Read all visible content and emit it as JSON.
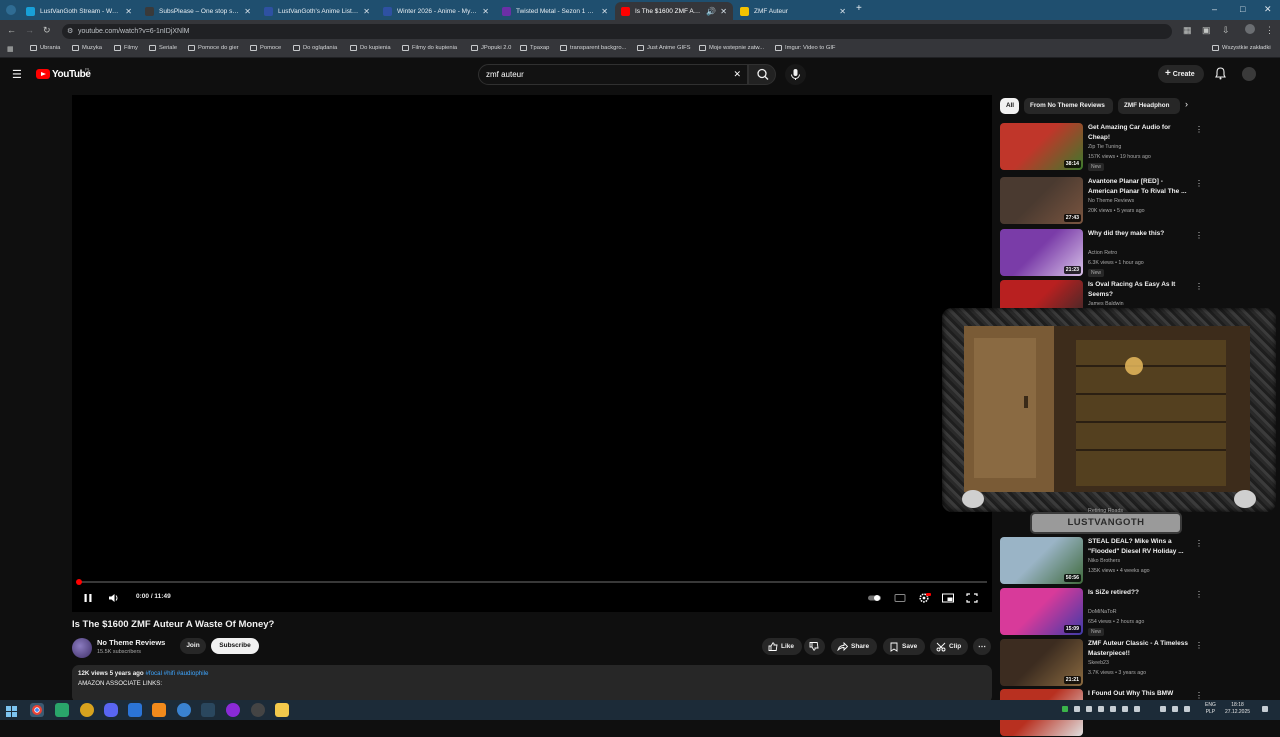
{
  "browser": {
    "tabs": [
      {
        "title": "LustVanGoth Stream - Watch Li",
        "favicon_color": "#18a0d8"
      },
      {
        "title": "SubsPlease – One stop shop fo",
        "favicon_color": "#3a3a3a"
      },
      {
        "title": "LustVanGoth's Anime List - My",
        "favicon_color": "#2e51a2"
      },
      {
        "title": "Winter 2026 - Anime - MyAnim",
        "favicon_color": "#2e51a2"
      },
      {
        "title": "Twisted Metal - Sezon 1 Odcin",
        "favicon_color": "#6b2fa6"
      },
      {
        "title": "Is The $1600 ZMF Auteur A",
        "favicon_color": "#ff0000"
      },
      {
        "title": "ZMF Auteur",
        "favicon_color": "#f2c200"
      }
    ],
    "new_tab": "+",
    "url": "youtube.com/watch?v=6-1nIDjXNlM",
    "bookmarks": [
      "Ubrania",
      "Muzyka",
      "Filmy",
      "Seriale",
      "Pomoce do gier",
      "Pomoce",
      "Do oglądania",
      "Do kupienia",
      "Filmy do kupienia",
      "JPopuki 2.0",
      "Tpaxap",
      "transparent backgro...",
      "Just Anime GIFS",
      "Moje wstepnie zatw...",
      "Imgur: Video to GIF"
    ],
    "all_bookmarks": "Wszystkie zakładki"
  },
  "youtube": {
    "logo": "YouTube",
    "country": "PL",
    "search_query": "zmf auteur",
    "create_label": "Create"
  },
  "player": {
    "time": "0:00 / 11:49",
    "progress_fraction": 0.0
  },
  "video": {
    "title": "Is The $1600 ZMF Auteur A Waste Of Money?",
    "channel": "No Theme Reviews",
    "subscribers": "15.5K subscribers",
    "join": "Join",
    "subscribe": "Subscribe",
    "like": "Like",
    "share": "Share",
    "save": "Save",
    "clip": "Clip",
    "views_meta": "12K views  5 years ago",
    "tags": "#focal #hifi #audiophile",
    "desc_line": "AMAZON ASSOCIATE LINKS:"
  },
  "chips": [
    "All",
    "From No Theme Reviews",
    "ZMF Headphon"
  ],
  "recommendations": [
    {
      "title": "Get Amazing Car Audio for Cheap!",
      "channel": "Zip Tie Tuning",
      "views": "157K views • 19 hours ago",
      "badge": "New",
      "duration": "38:14",
      "thumb": [
        "#c0362a",
        "#3c7a2c"
      ]
    },
    {
      "title": "Avantone Planar [RED] - American Planar To Rival The ...",
      "channel": "No Theme Reviews",
      "views": "20K views • 5 years ago",
      "badge": "",
      "duration": "27:43",
      "thumb": [
        "#4a3a30",
        "#7a5540"
      ]
    },
    {
      "title": "Why did they make this?",
      "channel": "Action Retro",
      "views": "6.3K views • 1 hour ago",
      "badge": "New",
      "duration": "21:23",
      "thumb": [
        "#7a3ca8",
        "#d8c2e8"
      ]
    },
    {
      "title": "Is Oval Racing As Easy As It Seems?",
      "channel": "James Baldwin",
      "views": "",
      "badge": "",
      "duration": "",
      "thumb": [
        "#b82020",
        "#2a2a2a"
      ]
    },
    {
      "title": "STEAL DEAL? Mike Wins a \"Flooded\" Diesel RV Holiday ...",
      "channel": "Niko Brothers",
      "views": "135K views • 4 weeks ago",
      "badge": "",
      "duration": "50:56",
      "thumb": [
        "#9ab4c6",
        "#3f6a3c"
      ]
    },
    {
      "title": "Is SiZe retired??",
      "channel": "DoMiNaToR",
      "views": "654 views • 2 hours ago",
      "badge": "New",
      "duration": "15:09",
      "thumb": [
        "#d83a9a",
        "#3e3aa8"
      ]
    },
    {
      "title": "ZMF Auteur Classic - A Timeless Masterpiece!!",
      "channel": "Skeeb23",
      "views": "3.7K views • 3 years ago",
      "badge": "",
      "duration": "21:21",
      "thumb": [
        "#3c2c20",
        "#8a6a40"
      ]
    },
    {
      "title": "I Found Out Why This BMW Was",
      "channel": "",
      "views": "",
      "badge": "",
      "duration": "",
      "thumb": [
        "#b83020",
        "#e0e0e0"
      ]
    }
  ],
  "overlay": {
    "badge": "LUSTVANGOTH",
    "peek_channel": "Retiring Roads"
  },
  "taskbar": {
    "lang": "ENG\nPLP",
    "time": "18:18",
    "date": "27.12.2025"
  }
}
